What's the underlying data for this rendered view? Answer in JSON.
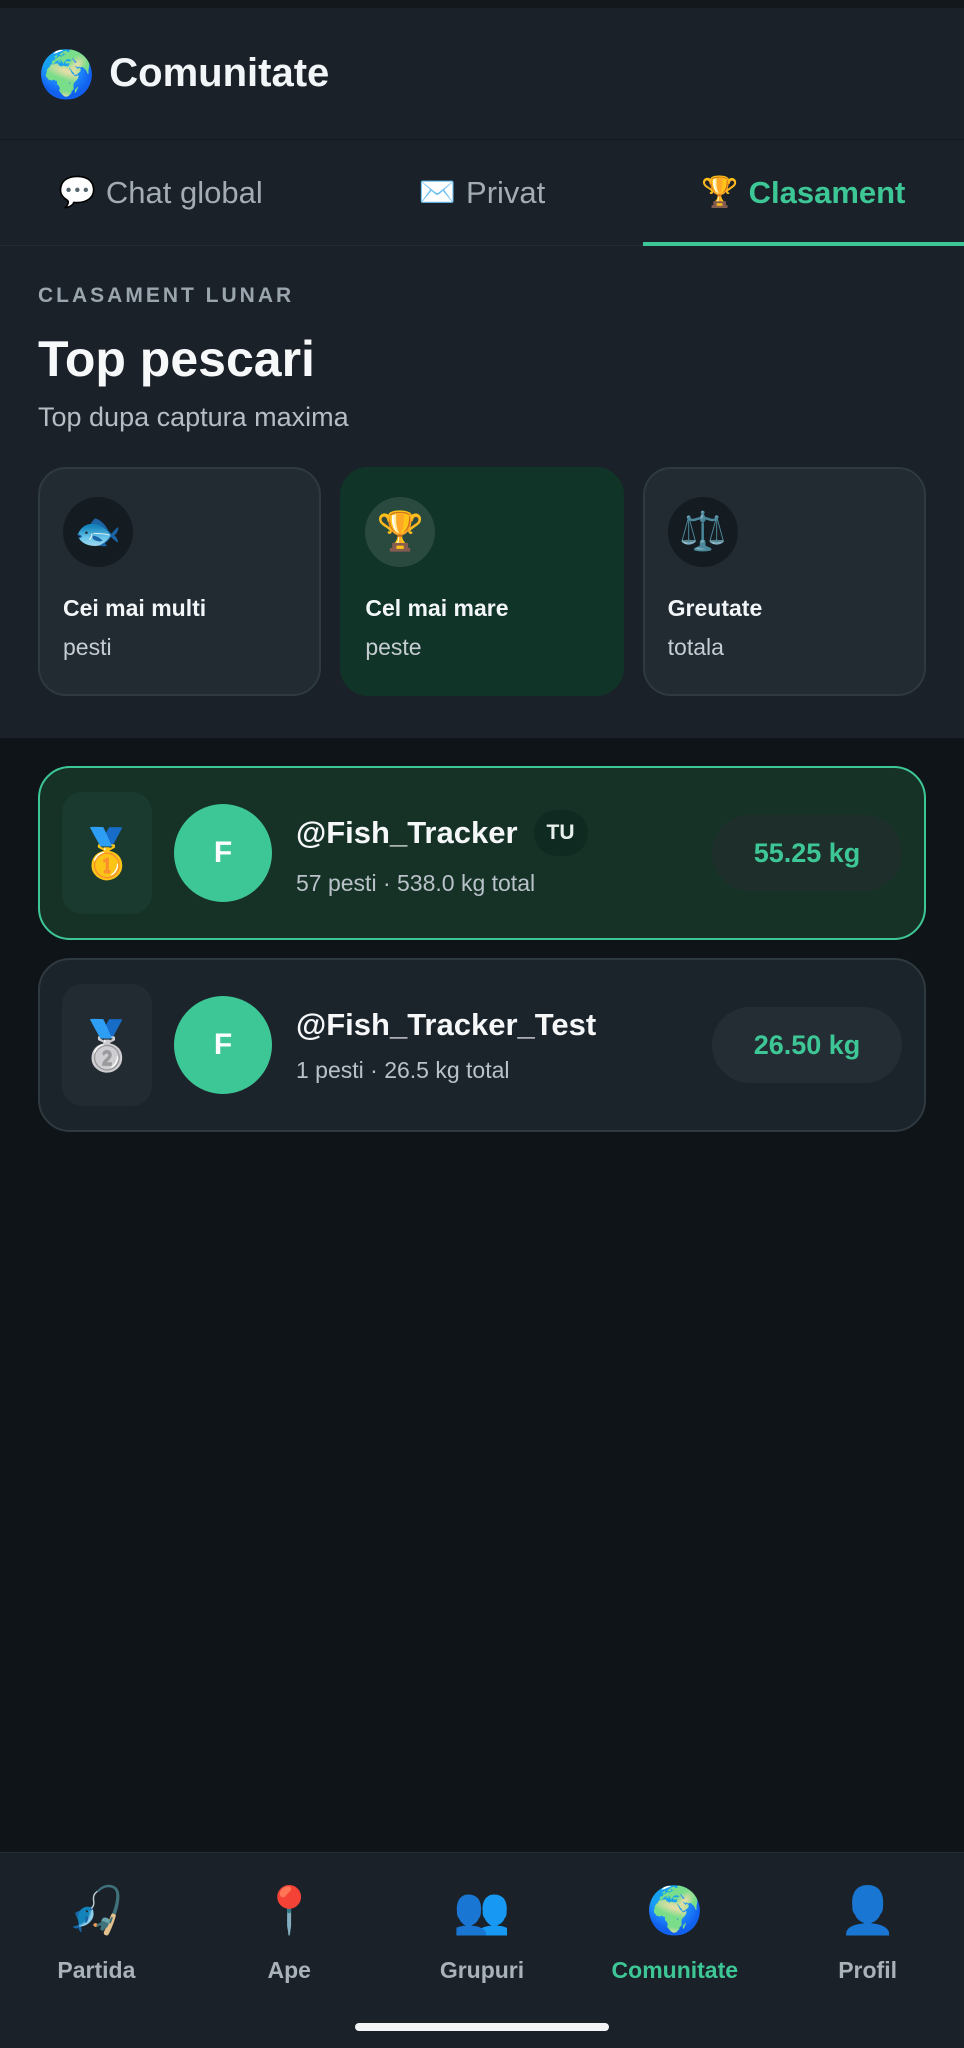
{
  "header": {
    "icon": "globe-icon",
    "title": "Comunitate"
  },
  "tabs": [
    {
      "icon": "speech-bubble-icon",
      "glyph": "💬",
      "label": "Chat global",
      "active": false
    },
    {
      "icon": "envelope-icon",
      "glyph": "✉️",
      "label": "Privat",
      "active": false
    },
    {
      "icon": "trophy-icon",
      "glyph": "🏆",
      "label": "Clasament",
      "active": true
    }
  ],
  "section": {
    "eyebrow": "CLASAMENT LUNAR",
    "title": "Top pescari",
    "subtitle": "Top dupa captura maxima"
  },
  "filters": [
    {
      "icon": "fish-icon",
      "glyph": "🐟",
      "line1": "Cei mai multi",
      "line2": "pesti",
      "active": false
    },
    {
      "icon": "trophy-icon",
      "glyph": "🏆",
      "line1": "Cel mai mare",
      "line2": "peste",
      "active": true
    },
    {
      "icon": "scale-icon",
      "glyph": "⚖️",
      "line1": "Greutate",
      "line2": "totala",
      "active": false
    }
  ],
  "leaderboard": [
    {
      "medal": "gold-medal-icon",
      "glyph": "🥇",
      "avatar": "F",
      "username": "@Fish_Tracker",
      "badge": "TU",
      "stats": "57 pesti · 538.0 kg total",
      "score": "55.25 kg",
      "is_me": true
    },
    {
      "medal": "silver-medal-icon",
      "glyph": "🥈",
      "avatar": "F",
      "username": "@Fish_Tracker_Test",
      "badge": "",
      "stats": "1 pesti · 26.5 kg total",
      "score": "26.50 kg",
      "is_me": false
    }
  ],
  "bottom_nav": [
    {
      "icon": "fishing-rod-icon",
      "glyph": "🎣",
      "label": "Partida",
      "active": false
    },
    {
      "icon": "map-pin-icon",
      "glyph": "📍",
      "label": "Ape",
      "active": false
    },
    {
      "icon": "users-icon",
      "glyph": "👥",
      "label": "Grupuri",
      "active": false
    },
    {
      "icon": "globe-icon",
      "glyph": "🌍",
      "label": "Comunitate",
      "active": true
    },
    {
      "icon": "user-icon",
      "glyph": "👤",
      "label": "Profil",
      "active": false
    }
  ],
  "colors": {
    "accent": "#3ec796",
    "background": "#0f1418",
    "surface": "#1a2128"
  }
}
